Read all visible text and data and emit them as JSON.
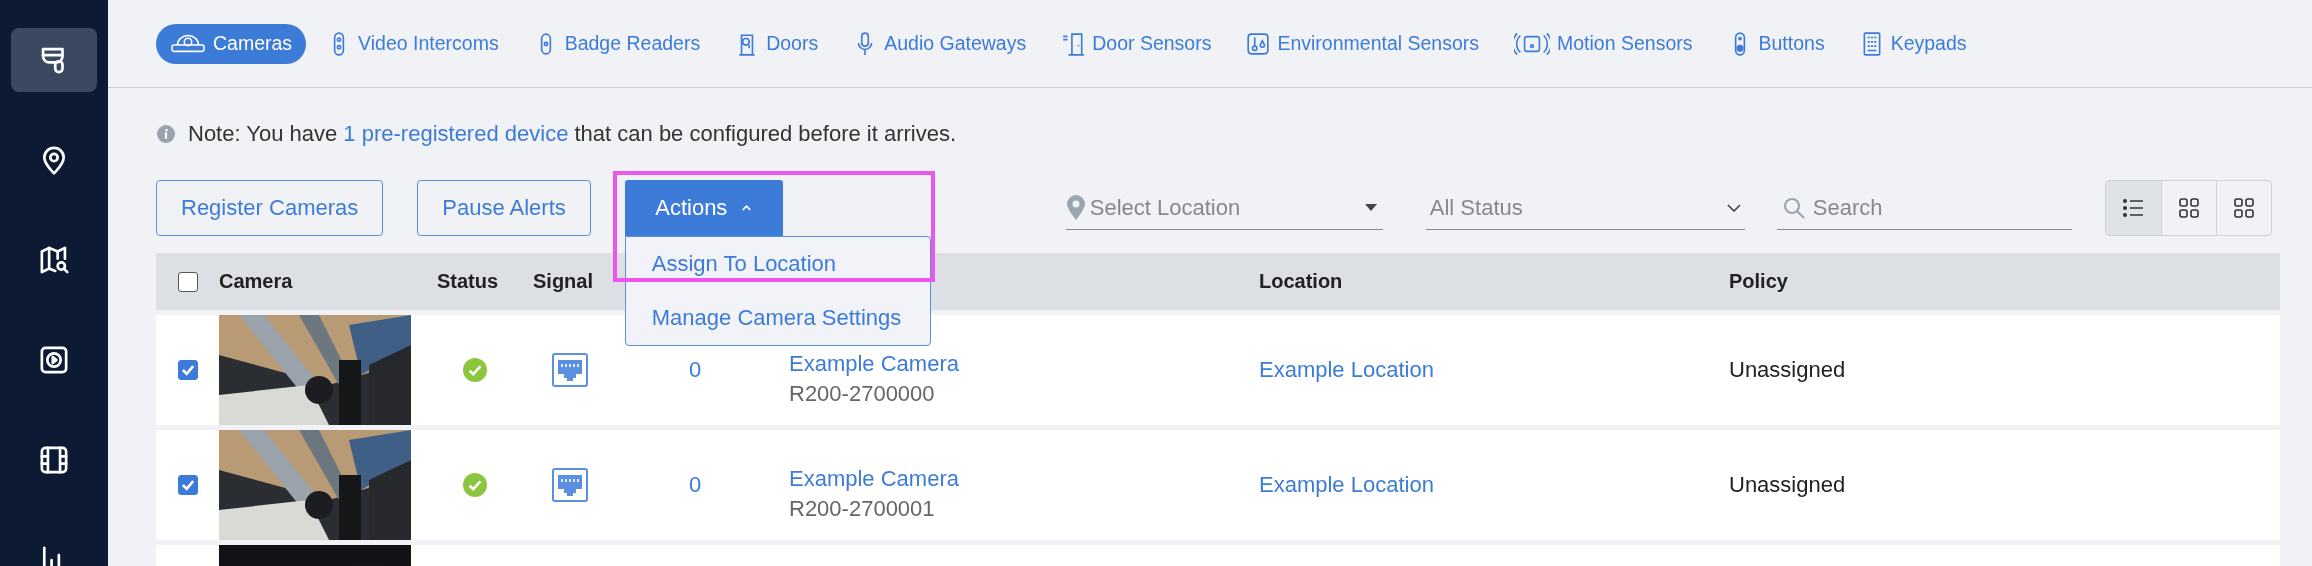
{
  "sidebar": {
    "items": [
      {
        "selected": true
      },
      {
        "selected": false
      },
      {
        "selected": false
      },
      {
        "selected": false
      },
      {
        "selected": false
      },
      {
        "selected": false
      }
    ]
  },
  "tabs": [
    {
      "label": "Cameras",
      "selected": true
    },
    {
      "label": "Video Intercoms",
      "selected": false
    },
    {
      "label": "Badge Readers",
      "selected": false
    },
    {
      "label": "Doors",
      "selected": false
    },
    {
      "label": "Audio Gateways",
      "selected": false
    },
    {
      "label": "Door Sensors",
      "selected": false
    },
    {
      "label": "Environmental Sensors",
      "selected": false
    },
    {
      "label": "Motion Sensors",
      "selected": false
    },
    {
      "label": "Buttons",
      "selected": false
    },
    {
      "label": "Keypads",
      "selected": false
    }
  ],
  "note": {
    "before": "Note: You have",
    "link": "1 pre-registered device",
    "after": "that can be configured before it arrives."
  },
  "toolbar": {
    "buttons": [
      "Register Cameras",
      "Pause Alerts"
    ],
    "actions": {
      "label": "Actions",
      "expanded": true,
      "highlighted": true,
      "menu": [
        "Assign To Location",
        "Manage Camera Settings"
      ]
    },
    "location_filter": {
      "placeholder": "Select Location"
    },
    "status_filter": {
      "value": "All Status"
    },
    "search": {
      "placeholder": "Search"
    },
    "views": [
      {
        "selected": true
      },
      {
        "selected": false
      },
      {
        "selected": false
      }
    ]
  },
  "table": {
    "select_all": {
      "checked": false
    },
    "columns": [
      "Camera",
      "Status",
      "Signal",
      "Location",
      "Policy"
    ],
    "rows": [
      {
        "kind": "camera",
        "checked": true,
        "online": true,
        "count": "0",
        "name": "Example Camera",
        "serial": "R200-2700000",
        "location": "Example Location",
        "policy": "Unassigned"
      },
      {
        "kind": "camera",
        "checked": true,
        "online": true,
        "count": "0",
        "name": "Example Camera",
        "serial": "R200-2700001",
        "location": "Example Location",
        "policy": "Unassigned"
      },
      {
        "kind": "partial"
      }
    ]
  }
}
